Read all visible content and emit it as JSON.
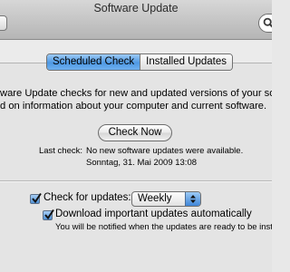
{
  "window": {
    "title": "Software Update"
  },
  "toolbar": {
    "search": {
      "value": "",
      "icon": "search-icon"
    }
  },
  "tabs": [
    {
      "label": "Scheduled Check",
      "selected": true
    },
    {
      "label": "Installed Updates",
      "selected": false
    }
  ],
  "description": {
    "line1": "ware Update checks for new and updated versions of your softw",
    "line2": "d on information about your computer and current software."
  },
  "check_now_button": {
    "label": "Check Now"
  },
  "last_check": {
    "label": "Last check:",
    "status": "No new software updates were available.",
    "date": "Sonntag, 31. Mai 2009 13:08"
  },
  "settings": {
    "check_for_updates": {
      "label": "Check for updates:",
      "checked": true
    },
    "frequency": {
      "selected": "Weekly"
    },
    "download_automatically": {
      "label": "Download important updates automatically",
      "checked": true,
      "note": "You will be notified when the updates are ready to be insta"
    }
  },
  "colors": {
    "accent": "#4e98e3",
    "window_bg": "#e8e8e8"
  }
}
